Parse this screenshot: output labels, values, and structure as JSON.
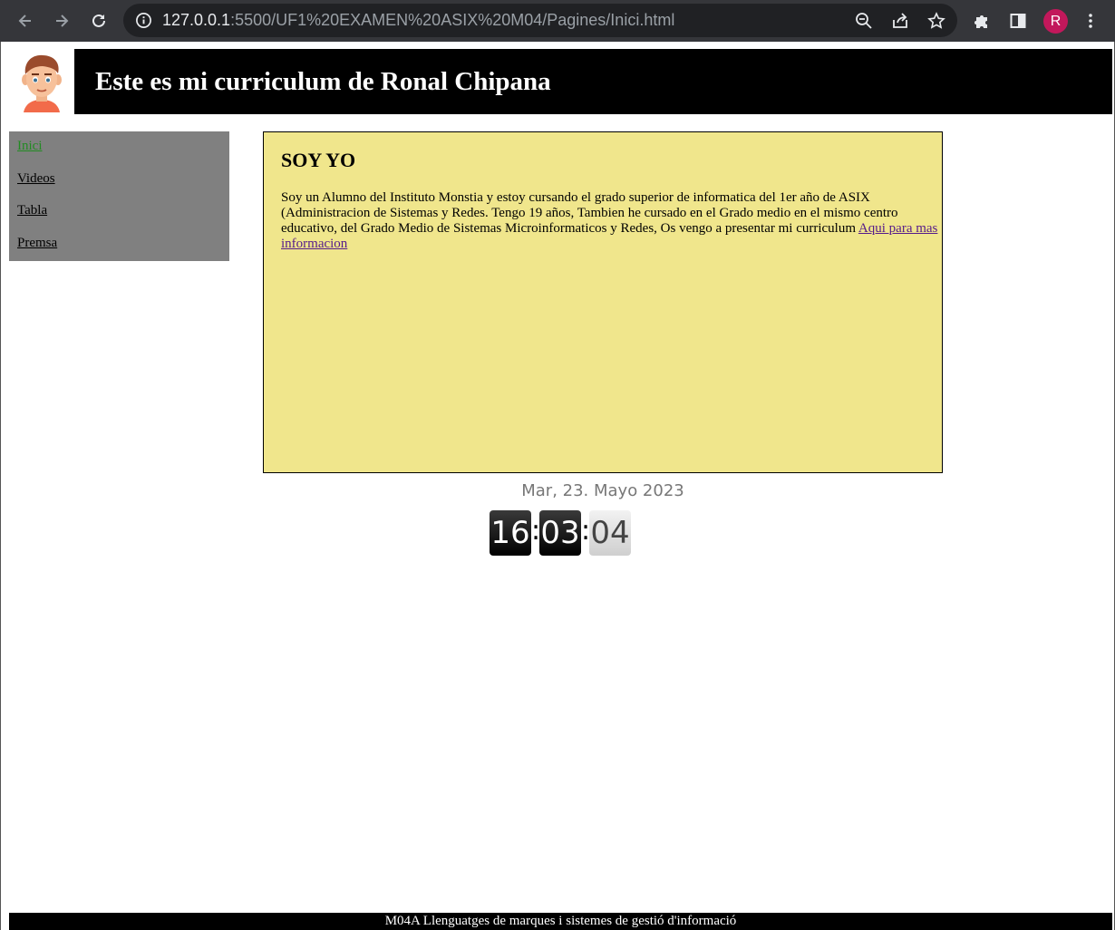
{
  "browser": {
    "url_host": "127.0.0.1",
    "url_rest": ":5500/UF1%20EXAMEN%20ASIX%20M04/Pagines/Inici.html",
    "profile_initial": "R",
    "profile_color": "#c2185b"
  },
  "header": {
    "title": "Este es mi curriculum de Ronal Chipana",
    "logo_icon": "boy-avatar-icon"
  },
  "sidebar": {
    "items": [
      {
        "label": "Inici",
        "active": true
      },
      {
        "label": "Videos",
        "active": false
      },
      {
        "label": "Tabla",
        "active": false
      },
      {
        "label": "Premsa",
        "active": false
      }
    ]
  },
  "main": {
    "heading": "SOY YO",
    "paragraph": "Soy un Alumno del Instituto Monstia y estoy cursando el grado superior de informatica del 1er año de ASIX (Administracion de Sistemas y Redes. Tengo 19 años, Tambien he cursado en el Grado medio en el mismo centro educativo, del Grado Medio de Sistemas Microinformaticos y Redes, Os vengo a presentar mi curriculum ",
    "link_text": "Aqui para mas informacion"
  },
  "clock": {
    "date": "Mar, 23. Mayo 2023",
    "hours": "16",
    "minutes": "03",
    "seconds": "04"
  },
  "footer": {
    "text": "M04A Llenguatges de marques i sistemes de gestió d'informació"
  },
  "colors": {
    "header_bg": "#000000",
    "sidebar_bg": "#808080",
    "main_bg": "#f0e68c",
    "active_link": "#228b22"
  }
}
